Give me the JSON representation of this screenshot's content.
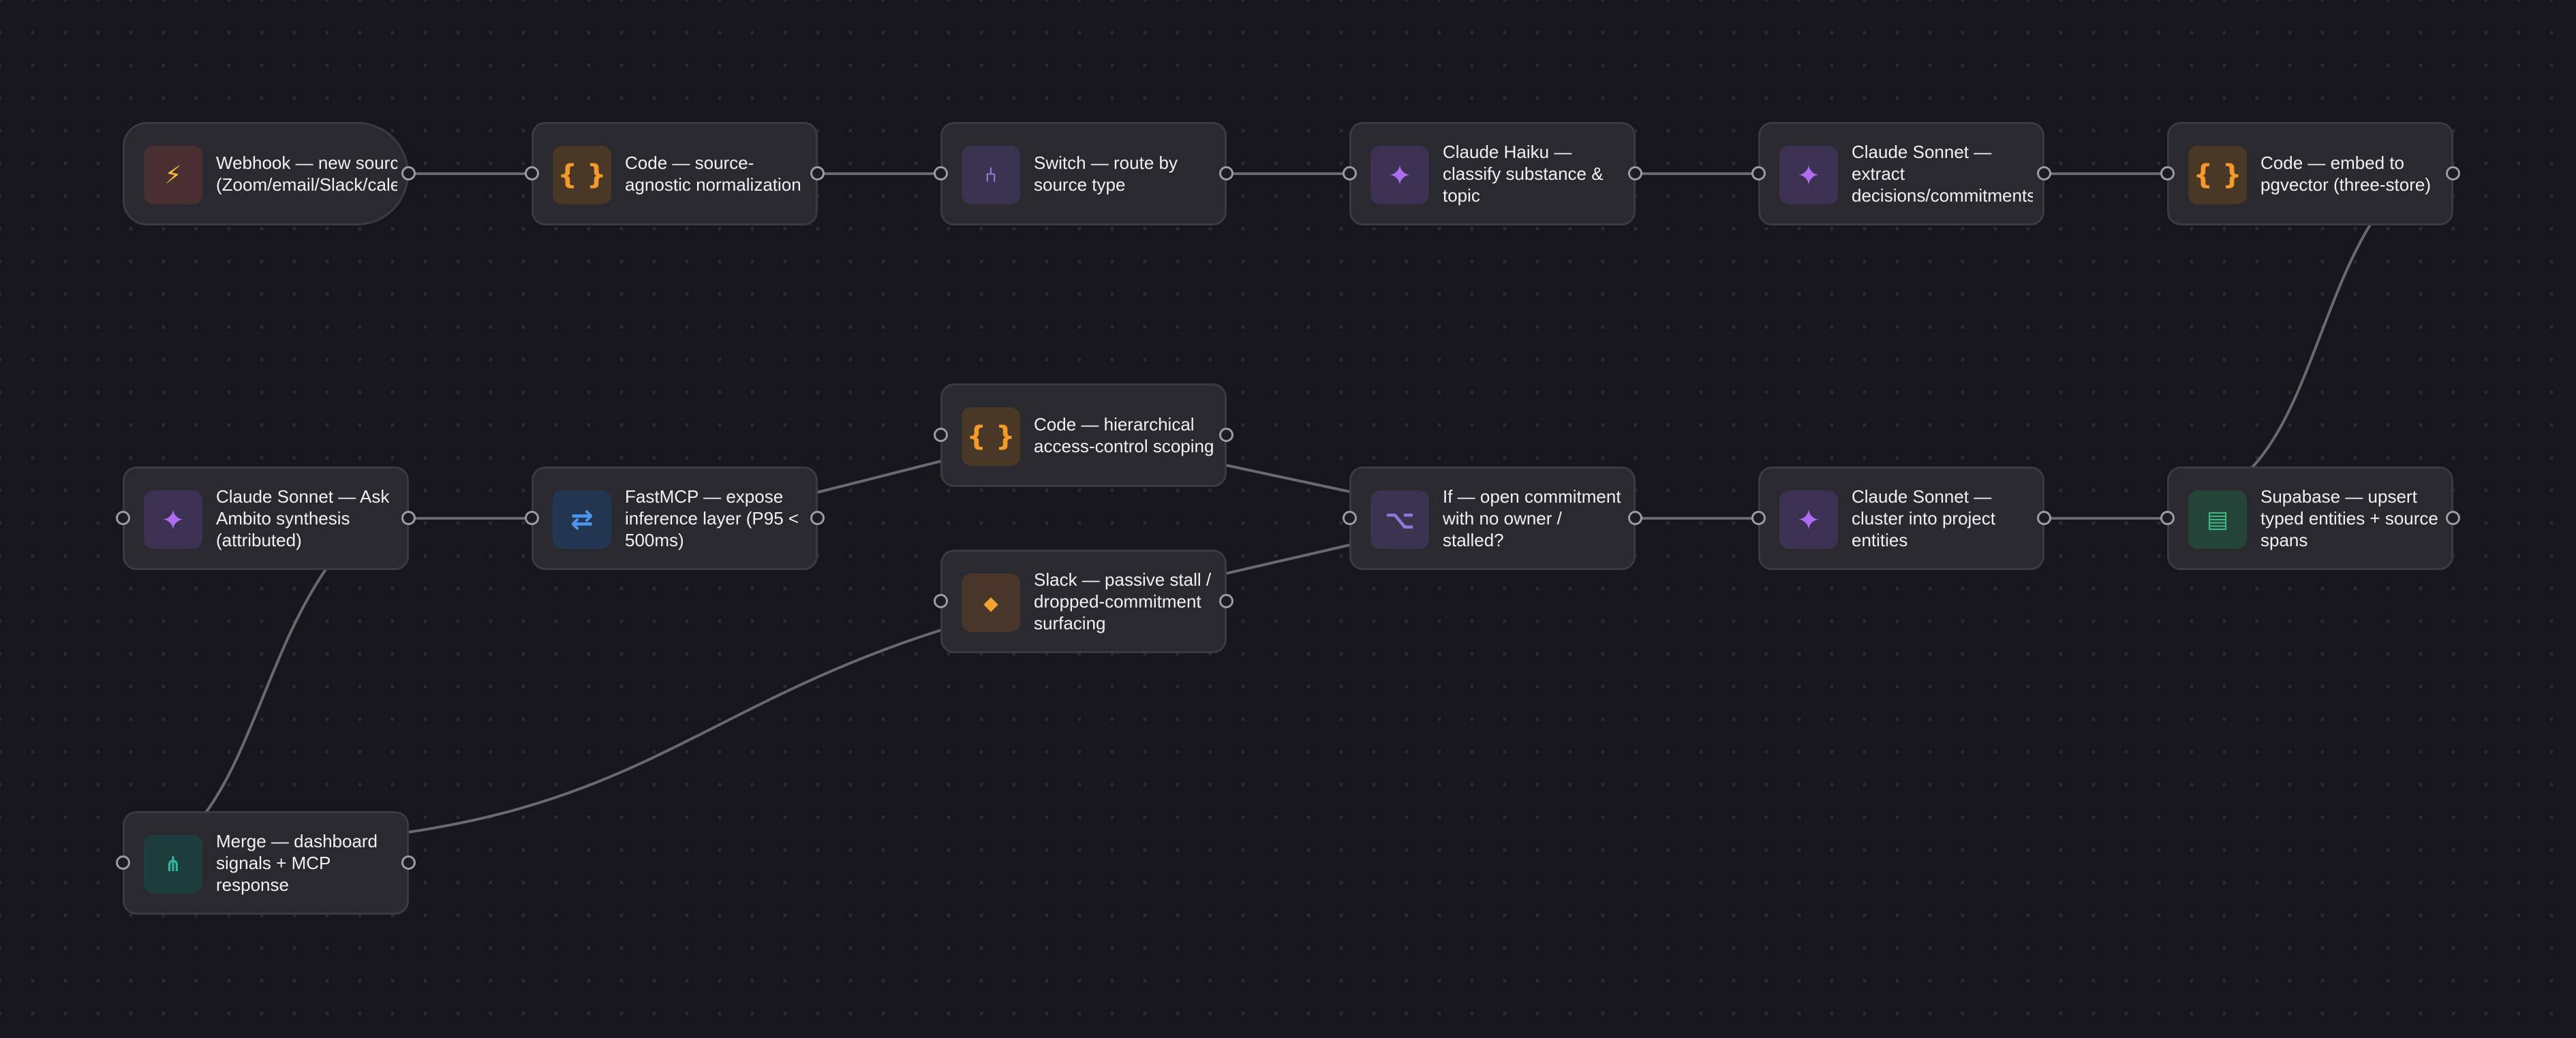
{
  "workflow": {
    "nodes": [
      {
        "id": "webhook",
        "label": "Webhook — new source (Zoom/email/Slack/calendar)",
        "icon": "lightning-icon",
        "color": "#f2c13a"
      },
      {
        "id": "code_norm",
        "label": "Code — source-agnostic normalization",
        "icon": "code-braces-icon",
        "color": "#f39a2b"
      },
      {
        "id": "switch",
        "label": "Switch — route by source type",
        "icon": "switch-branch-icon",
        "color": "#8d7bd6"
      },
      {
        "id": "haiku",
        "label": "Claude Haiku — classify substance & topic",
        "icon": "sparkle-icon",
        "color": "#b06cf0"
      },
      {
        "id": "sonnet_extract",
        "label": "Claude Sonnet — extract decisions/commitments",
        "icon": "sparkle-icon",
        "color": "#b06cf0"
      },
      {
        "id": "code_embed",
        "label": "Code — embed to pgvector (three-store)",
        "icon": "code-braces-icon",
        "color": "#f39a2b"
      },
      {
        "id": "code_access",
        "label": "Code — hierarchical access-control scoping",
        "icon": "code-braces-icon",
        "color": "#f39a2b"
      },
      {
        "id": "sonnet_ask",
        "label": "Claude Sonnet — Ask Ambito synthesis (attributed)",
        "icon": "sparkle-icon",
        "color": "#b06cf0"
      },
      {
        "id": "fastmcp",
        "label": "FastMCP — expose inference layer (P95 < 500ms)",
        "icon": "arrows-exchange-icon",
        "color": "#4b96ea"
      },
      {
        "id": "if_open",
        "label": "If — open commitment with no owner / stalled?",
        "icon": "if-branch-icon",
        "color": "#8d7bd6"
      },
      {
        "id": "sonnet_cluster",
        "label": "Claude Sonnet — cluster into project entities",
        "icon": "sparkle-icon",
        "color": "#b06cf0"
      },
      {
        "id": "supabase",
        "label": "Supabase — upsert typed entities + source spans",
        "icon": "database-icon",
        "color": "#3fbe8a"
      },
      {
        "id": "slack",
        "label": "Slack — passive stall / dropped-commitment surfacing",
        "icon": "slack-diamond-icon",
        "color": "#f0a233"
      },
      {
        "id": "merge",
        "label": "Merge — dashboard signals + MCP response",
        "icon": "merge-icon",
        "color": "#30b7a3"
      }
    ],
    "connections": [
      [
        "webhook",
        "code_norm"
      ],
      [
        "code_norm",
        "switch"
      ],
      [
        "switch",
        "haiku"
      ],
      [
        "haiku",
        "sonnet_extract"
      ],
      [
        "sonnet_extract",
        "code_embed"
      ],
      [
        "code_embed",
        "supabase"
      ],
      [
        "sonnet_cluster",
        "supabase"
      ],
      [
        "if_open",
        "sonnet_cluster"
      ],
      [
        "code_access",
        "if_open"
      ],
      [
        "slack",
        "if_open"
      ],
      [
        "fastmcp",
        "code_access"
      ],
      [
        "sonnet_ask",
        "fastmcp"
      ],
      [
        "sonnet_ask",
        "merge"
      ],
      [
        "slack",
        "merge"
      ]
    ]
  }
}
